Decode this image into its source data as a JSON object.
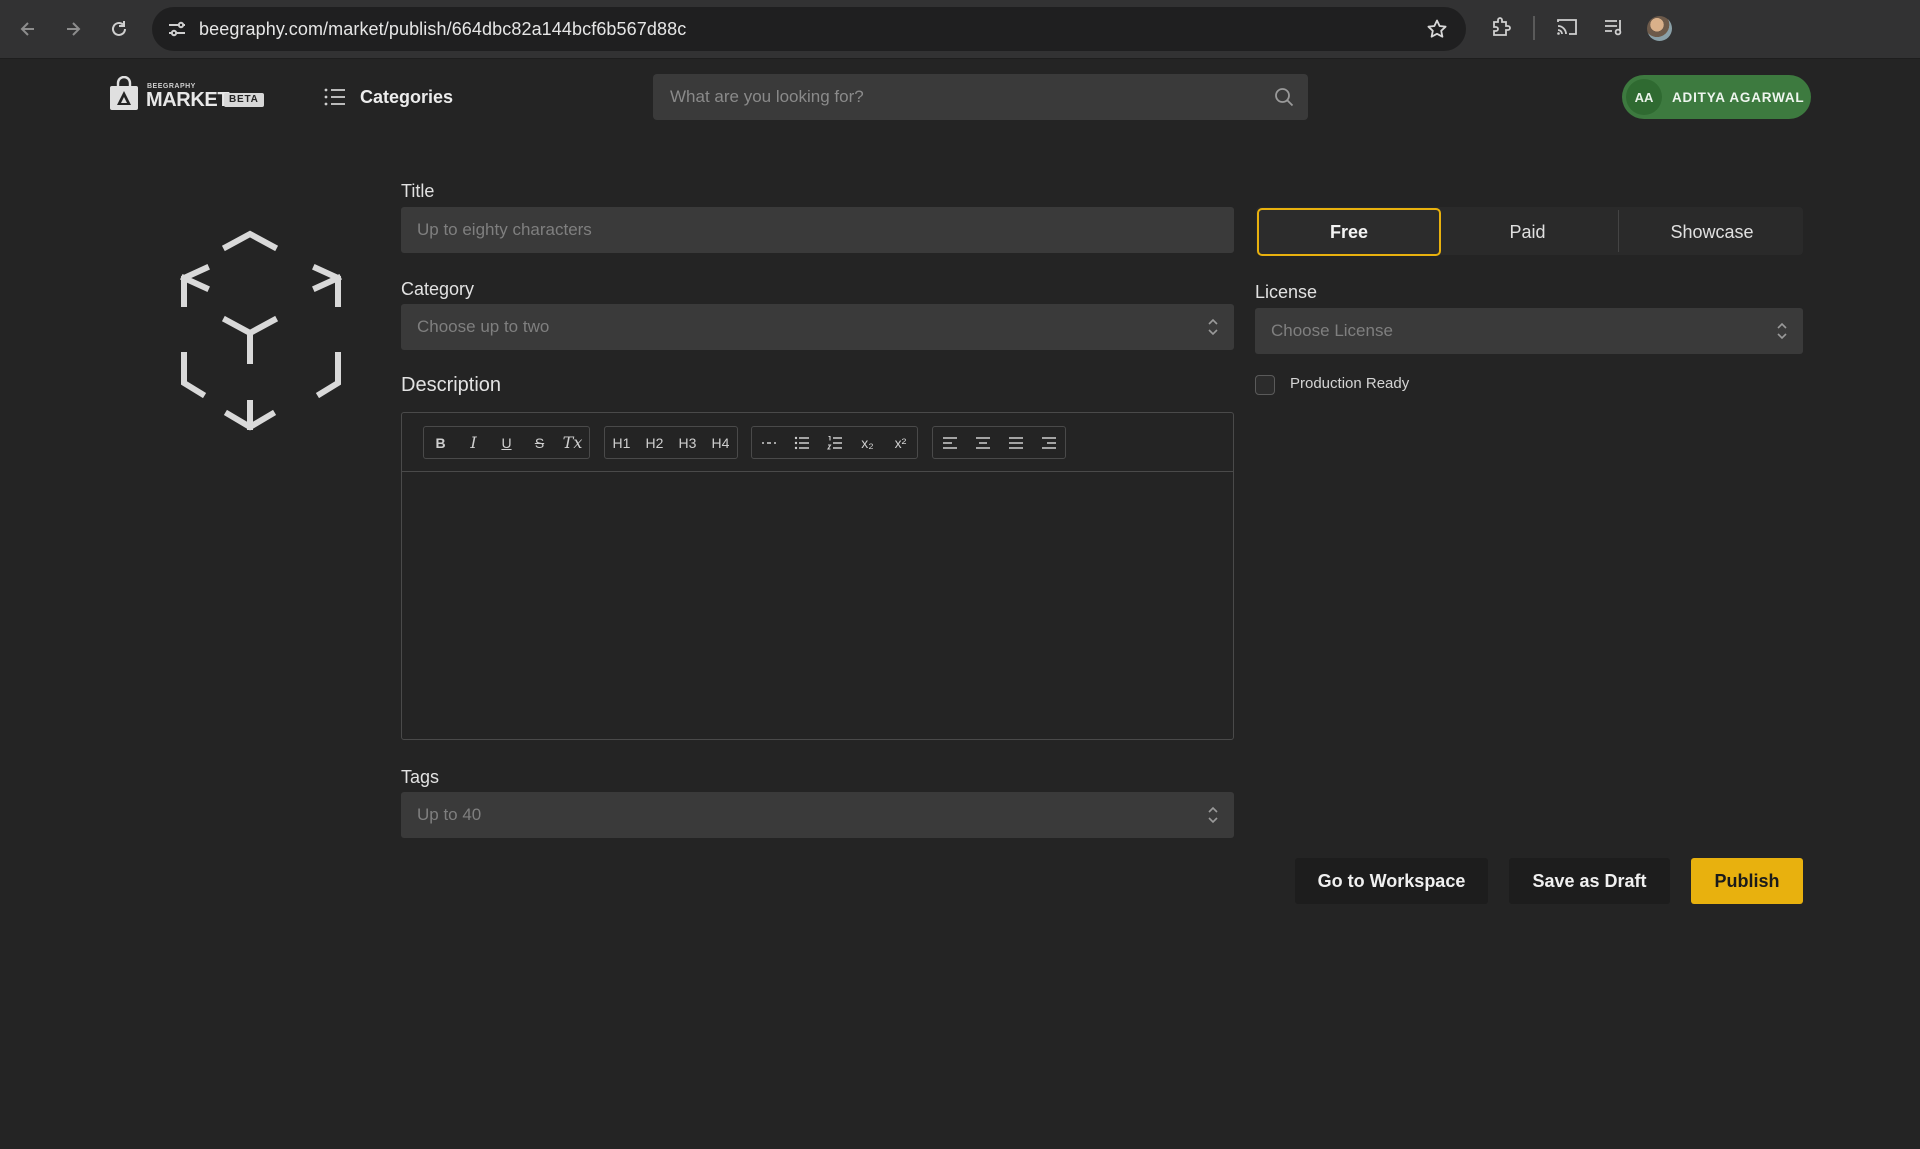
{
  "browser": {
    "url": "beegraphy.com/market/publish/664dbc82a144bcf6b567d88c"
  },
  "header": {
    "logo_small": "BEEGRAPHY",
    "logo_word": "MARKET",
    "logo_badge": "BETA",
    "categories_label": "Categories",
    "search_placeholder": "What are you looking for?",
    "user_initials": "AA",
    "user_name": "ADITYA AGARWAL"
  },
  "form": {
    "title_label": "Title",
    "title_placeholder": "Up to eighty characters",
    "category_label": "Category",
    "category_placeholder": "Choose up to two",
    "description_label": "Description",
    "tags_label": "Tags",
    "tags_placeholder": "Up to 40",
    "toolbar": {
      "format": [
        "B",
        "I",
        "U",
        "S",
        "Tx"
      ],
      "headings": [
        "H1",
        "H2",
        "H3",
        "H4"
      ],
      "lists": [
        "—",
        "•",
        "1.",
        "x₂",
        "x²"
      ],
      "align": [
        "left",
        "center",
        "justify",
        "right"
      ]
    }
  },
  "pricing": {
    "options": [
      "Free",
      "Paid",
      "Showcase"
    ],
    "selected": "Free"
  },
  "license": {
    "label": "License",
    "placeholder": "Choose License"
  },
  "production_ready": {
    "label": "Production Ready",
    "checked": false
  },
  "actions": {
    "workspace": "Go to Workspace",
    "draft": "Save as Draft",
    "publish": "Publish"
  },
  "colors": {
    "accent": "#e8b10e",
    "user_badge": "#3d7a3f",
    "background": "#242424"
  }
}
